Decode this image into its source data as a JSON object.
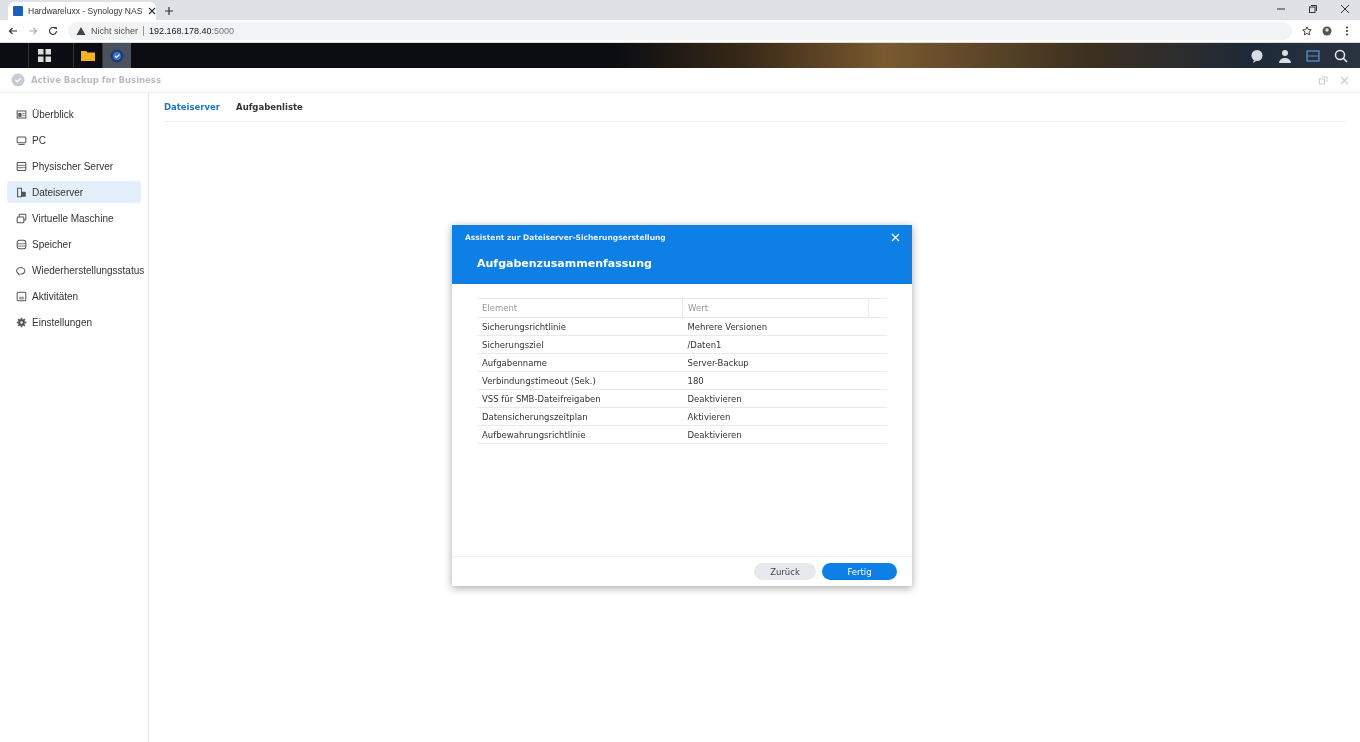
{
  "browser": {
    "tab_title": "Hardwareluxx - Synology NAS",
    "security": "Nicht sicher",
    "address": "192.168.178.40",
    "port": ":5000"
  },
  "app": {
    "title": "Active Backup for Business"
  },
  "sidebar": {
    "items": [
      {
        "label": "Überblick",
        "selected": false
      },
      {
        "label": "PC",
        "selected": false
      },
      {
        "label": "Physischer Server",
        "selected": false
      },
      {
        "label": "Dateiserver",
        "selected": true
      },
      {
        "label": "Virtuelle Maschine",
        "selected": false
      },
      {
        "label": "Speicher",
        "selected": false
      },
      {
        "label": "Wiederherstellungsstatus",
        "selected": false
      },
      {
        "label": "Aktivitäten",
        "selected": false
      },
      {
        "label": "Einstellungen",
        "selected": false
      }
    ]
  },
  "tabs": [
    {
      "label": "Dateiserver",
      "selected": true
    },
    {
      "label": "Aufgabenliste",
      "selected": false
    }
  ],
  "dialog": {
    "wizard_title": "Assistent zur Dateiserver-Sicherungserstellung",
    "step_title": "Aufgabenzusammenfassung",
    "table": {
      "columns": [
        "Element",
        "Wert"
      ],
      "rows": [
        [
          "Sicherungsrichtlinie",
          "Mehrere Versionen"
        ],
        [
          "Sicherungsziel",
          "/Daten1"
        ],
        [
          "Aufgabenname",
          "Server-Backup"
        ],
        [
          "Verbindungstimeout (Sek.)",
          "180"
        ],
        [
          "VSS für SMB-Dateifreigaben",
          "Deaktivieren"
        ],
        [
          "Datensicherungszeitplan",
          "Aktivieren"
        ],
        [
          "Aufbewahrungsrichtlinie",
          "Deaktivieren"
        ]
      ]
    },
    "buttons": [
      {
        "label": "Zurück",
        "kind": "secondary"
      },
      {
        "label": "Fertig",
        "kind": "primary"
      }
    ]
  }
}
